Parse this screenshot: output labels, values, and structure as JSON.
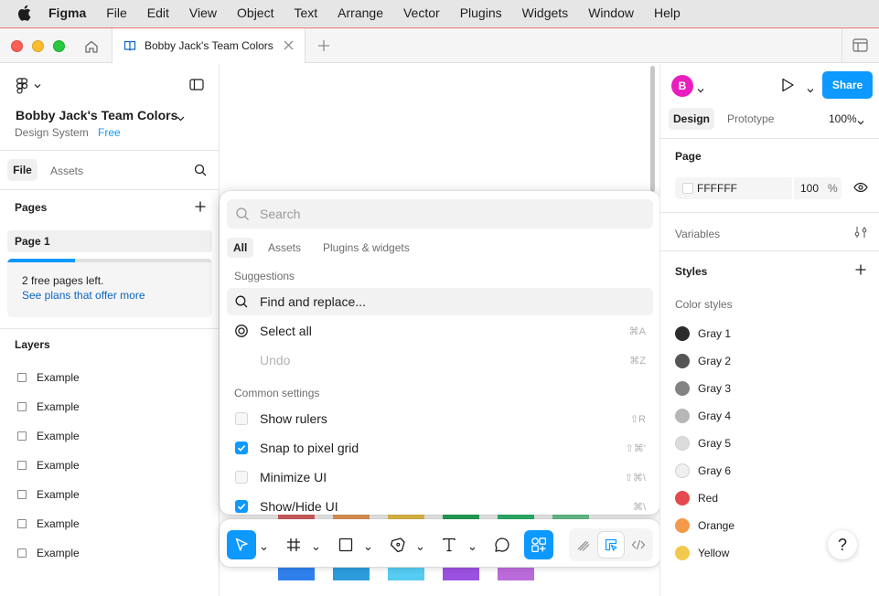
{
  "menubar": {
    "app": "Figma",
    "items": [
      "File",
      "Edit",
      "View",
      "Object",
      "Text",
      "Arrange",
      "Vector",
      "Plugins",
      "Widgets",
      "Window",
      "Help"
    ]
  },
  "tabbar": {
    "tab_title": "Bobby Jack's Team Colors"
  },
  "left_panel": {
    "file_name": "Bobby Jack's Team Colors",
    "file_type": "Design System",
    "plan": "Free",
    "tabs": {
      "file": "File",
      "assets": "Assets"
    },
    "pages_title": "Pages",
    "pages": [
      "Page 1"
    ],
    "free_pages": {
      "text": "2 free pages left.",
      "link": "See plans that offer more",
      "used_fraction": 0.33
    },
    "layers_title": "Layers",
    "layers": [
      "Example",
      "Example",
      "Example",
      "Example",
      "Example",
      "Example",
      "Example"
    ]
  },
  "popup": {
    "search_placeholder": "Search",
    "filters": [
      "All",
      "Assets",
      "Plugins & widgets"
    ],
    "sections": {
      "suggestions": "Suggestions",
      "common": "Common settings"
    },
    "suggestions": [
      {
        "label": "Find and replace...",
        "shortcut": "",
        "icon": "search-icon"
      },
      {
        "label": "Select all",
        "shortcut": "⌘A",
        "icon": "target-icon"
      },
      {
        "label": "Undo",
        "shortcut": "⌘Z",
        "icon": ""
      }
    ],
    "settings": [
      {
        "label": "Show rulers",
        "shortcut": "⇧R",
        "checked": false
      },
      {
        "label": "Snap to pixel grid",
        "shortcut": "⇧⌘'",
        "checked": true
      },
      {
        "label": "Minimize UI",
        "shortcut": "⇧⌘\\",
        "checked": false
      },
      {
        "label": "Show/Hide UI",
        "shortcut": "⌘\\",
        "checked": true
      }
    ]
  },
  "right_panel": {
    "avatar_initial": "B",
    "share": "Share",
    "tabs": {
      "design": "Design",
      "prototype": "Prototype"
    },
    "zoom": "100%",
    "page_title": "Page",
    "page_color": "FFFFFF",
    "page_opacity": "100",
    "page_opacity_unit": "%",
    "variables": "Variables",
    "styles": "Styles",
    "color_styles_title": "Color styles",
    "color_styles": [
      {
        "name": "Gray 1",
        "color": "#2c2c2c"
      },
      {
        "name": "Gray 2",
        "color": "#555555"
      },
      {
        "name": "Gray 3",
        "color": "#838383"
      },
      {
        "name": "Gray 4",
        "color": "#b7b7b7"
      },
      {
        "name": "Gray 5",
        "color": "#dcdcdc"
      },
      {
        "name": "Gray 6",
        "color": "#efefef"
      },
      {
        "name": "Red",
        "color": "#e5484d"
      },
      {
        "name": "Orange",
        "color": "#f2994a"
      },
      {
        "name": "Yellow",
        "color": "#f2c94c"
      }
    ],
    "help": "?"
  },
  "canvas": {
    "swatch_colors_row1": [
      "#e06666",
      "#f1a25a",
      "#f2c94c",
      "#27ae60",
      "#2fbf71",
      "#6fcf97"
    ],
    "swatch_colors_row2": [
      "#2f80ed",
      "#2d9cdb",
      "#56ccf2",
      "#9b51e0",
      "#bb6bd9"
    ]
  },
  "colors": {
    "accent": "#0d99ff"
  }
}
